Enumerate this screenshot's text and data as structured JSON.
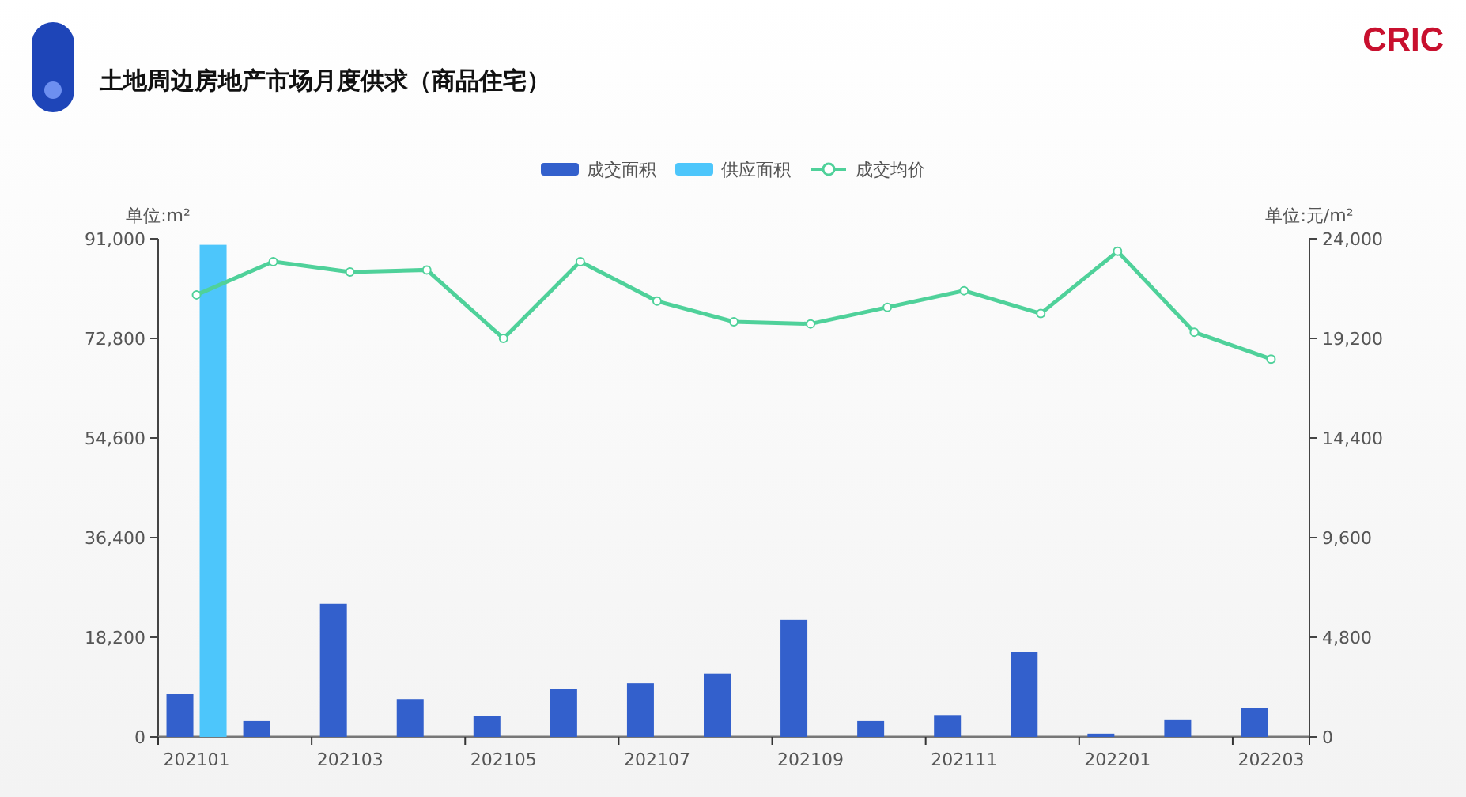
{
  "header": {
    "title": "土地周边房地产市场月度供求（商品住宅）",
    "brand": "CRIC"
  },
  "chart": {
    "chart_data": {
      "type": "bar",
      "categories": [
        "202101",
        null,
        "202103",
        null,
        "202105",
        null,
        "202107",
        null,
        "202109",
        null,
        "202111",
        null,
        "202201",
        null,
        "202203"
      ],
      "ylabel": "单位:m²",
      "y2label": "单位:元/m²",
      "ylim": [
        0,
        91000
      ],
      "yticks": [
        {
          "value": 0,
          "label": "0"
        },
        {
          "value": 18200,
          "label": "18,200"
        },
        {
          "value": 36400,
          "label": "36,400"
        },
        {
          "value": 54600,
          "label": "54,600"
        },
        {
          "value": 72800,
          "label": "72,800"
        },
        {
          "value": 91000,
          "label": "91,000"
        }
      ],
      "y2lim": [
        0,
        24000
      ],
      "y2ticks": [
        {
          "value": 0,
          "label": "0"
        },
        {
          "value": 4800,
          "label": "4,800"
        },
        {
          "value": 9600,
          "label": "9,600"
        },
        {
          "value": 14400,
          "label": "14,400"
        },
        {
          "value": 19200,
          "label": "19,200"
        },
        {
          "value": 24000,
          "label": "24,000"
        }
      ],
      "series": [
        {
          "name": "成交面积",
          "color": "#3360cc",
          "values": [
            7800,
            2900,
            24300,
            6900,
            3800,
            8700,
            9800,
            11600,
            21400,
            2900,
            4000,
            15600,
            600,
            3200,
            5200
          ]
        },
        {
          "name": "供应面积",
          "color": "#4dc6fb",
          "values": [
            89900,
            null,
            null,
            null,
            null,
            null,
            null,
            null,
            null,
            null,
            null,
            null,
            null,
            null,
            null
          ]
        },
        {
          "name": "成交均价",
          "type": "line",
          "axis": "y2",
          "marker": "circle",
          "color": "#4fd19a",
          "values": [
            21300,
            22900,
            22400,
            22500,
            19200,
            22900,
            21000,
            20000,
            19900,
            20700,
            21500,
            20400,
            23400,
            19500,
            18200
          ]
        }
      ]
    }
  }
}
